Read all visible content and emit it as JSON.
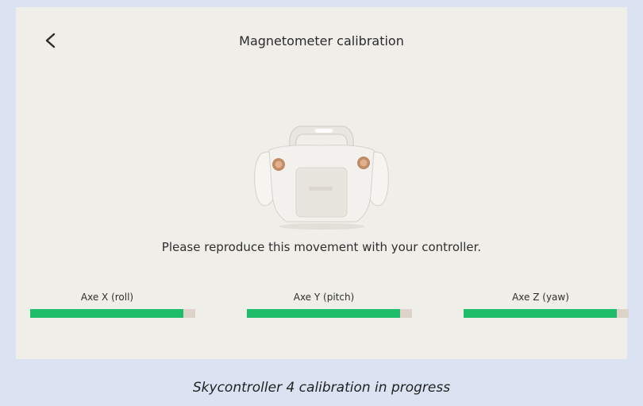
{
  "screen": {
    "title": "Magnetometer calibration",
    "instruction": "Please reproduce this movement with your controller.",
    "back_icon": "chevron-left-icon",
    "illustration": "controller-illustration"
  },
  "axes": [
    {
      "label": "Axe X (roll)",
      "progress": 0.93
    },
    {
      "label": "Axe Y (pitch)",
      "progress": 0.93
    },
    {
      "label": "Axe Z (yaw)",
      "progress": 0.93
    }
  ],
  "caption": "Skycontroller 4 calibration in progress",
  "colors": {
    "background": "#f0eee9",
    "progress_fill": "#1fbc6a",
    "progress_track": "#ddd3c8",
    "page_background": "#dbe3f2"
  }
}
